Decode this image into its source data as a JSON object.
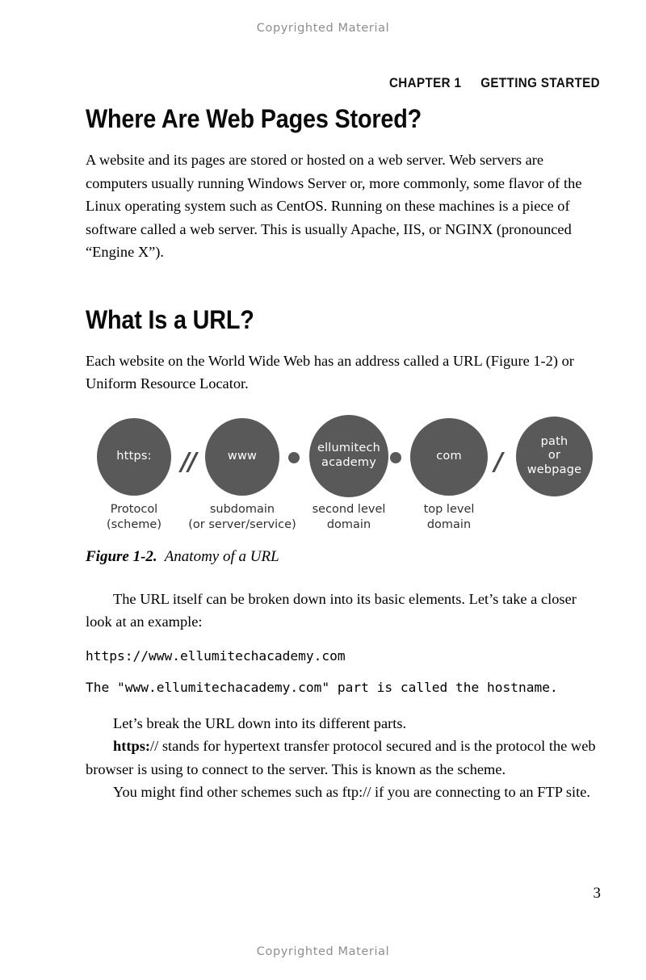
{
  "page": {
    "watermark_top": "Copyrighted Material",
    "watermark_bottom": "Copyrighted Material",
    "page_number": "3"
  },
  "running_head": {
    "chapter": "CHAPTER 1",
    "title": "GETTING STARTED"
  },
  "sections": {
    "heading_1": "Where Are Web Pages Stored?",
    "paragraph_1": "A website and its pages are stored or hosted on a web server. Web servers are computers usually running Windows Server or, more commonly, some flavor of the Linux operating system such as CentOS. Running on these machines is a piece of software called a web server. This is usually Apache, IIS, or NGINX (pronounced “Engine X”).",
    "heading_2": "What Is a URL?",
    "paragraph_2": "Each website on the World Wide Web has an address called a URL (Figure 1-2) or Uniform Resource Locator.",
    "paragraph_3": "The URL itself can be broken down into its basic elements. Let’s take a closer look at an example:",
    "code_1": "https://www.ellumitechacademy.com",
    "code_2": "The \"www.ellumitechacademy.com\" part is called the hostname.",
    "paragraph_4": "Let’s break the URL down into its different parts.",
    "paragraph_5_bold": "https:",
    "paragraph_5_rest": "// stands for hypertext transfer protocol secured and is the protocol the web browser is using to connect to the server. This is known as the scheme.",
    "paragraph_6": "You might find other schemes such as ftp:// if you are connecting to an FTP site."
  },
  "figure": {
    "caption_label": "Figure 1-2.",
    "caption_title": "Anatomy of a URL",
    "node_color": "#595959",
    "nodes": [
      {
        "text": "https:",
        "label": "Protocol\n(scheme)"
      },
      {
        "text": "www",
        "label": "subdomain\n(or server/service)"
      },
      {
        "text": "ellumitech\nacademy",
        "label": "second level\ndomain"
      },
      {
        "text": "com",
        "label": "top level\ndomain"
      },
      {
        "text": "path\nor\nwebpage",
        "label": ""
      }
    ],
    "separators": [
      "//",
      "•",
      "•",
      "/"
    ],
    "node_1_text": "https:",
    "node_2_text": "www",
    "node_3_text_line1": "ellumitech",
    "node_3_text_line2": "academy",
    "node_4_text": "com",
    "node_5_text_line1": "path",
    "node_5_text_line2": "or",
    "node_5_text_line3": "webpage",
    "label_1_line1": "Protocol",
    "label_1_line2": "(scheme)",
    "label_2_line1": "subdomain",
    "label_2_line2": "(or server/service)",
    "label_3_line1": "second level",
    "label_3_line2": "domain",
    "label_4_line1": "top level",
    "label_4_line2": "domain",
    "sep_1": "//",
    "sep_2": "•",
    "sep_3": "•",
    "sep_4": "/"
  }
}
